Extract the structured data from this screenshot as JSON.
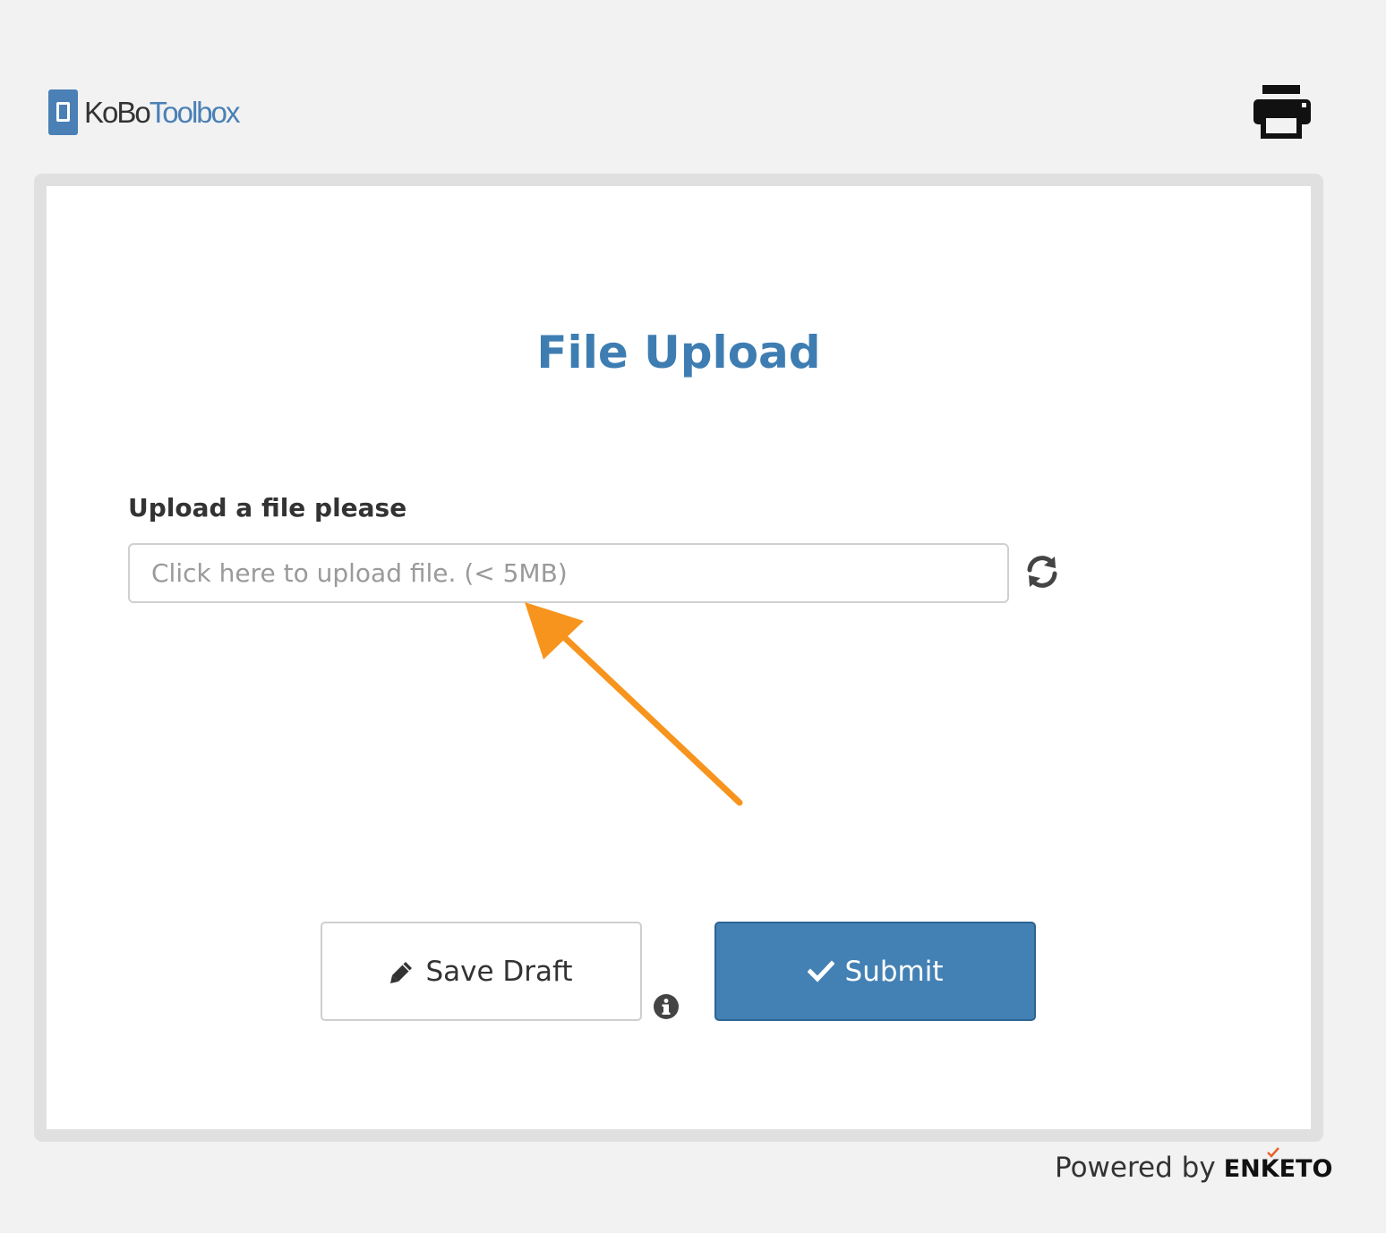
{
  "header": {
    "logo_text_1": "KoBo",
    "logo_text_2": "Toolbox",
    "print_icon": "printer-icon"
  },
  "form": {
    "title": "File Upload",
    "question": {
      "label": "Upload a file please",
      "placeholder": "Click here to upload file. (< 5MB)",
      "reset_icon": "refresh-icon"
    },
    "buttons": {
      "save_draft_label": "Save Draft",
      "save_draft_icon": "pencil-icon",
      "info_icon": "info-icon",
      "submit_label": "Submit",
      "submit_icon": "check-icon"
    }
  },
  "footer": {
    "powered_by": "Powered by",
    "brand": "ENKETO"
  },
  "colors": {
    "background": "#f2f2f2",
    "brand_blue": "#4381b4",
    "title_blue": "#3e7db2",
    "annotation_orange": "#f7941d"
  }
}
